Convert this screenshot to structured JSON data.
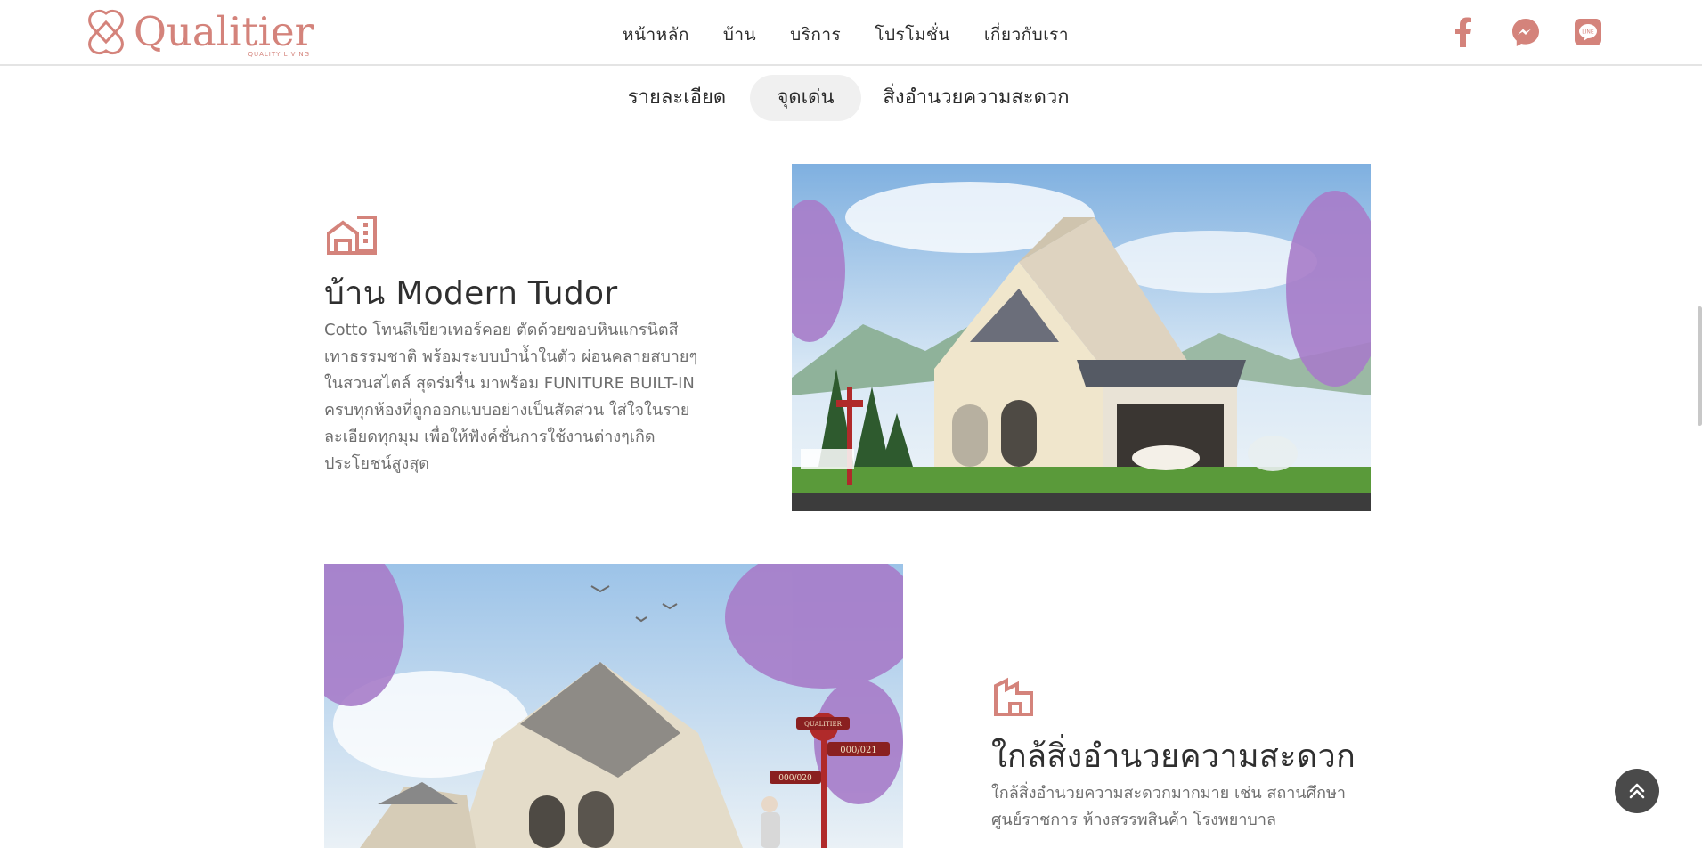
{
  "header": {
    "logo_text": "Qualitier",
    "logo_tagline": "QUALITY  LIVING",
    "nav": [
      "หน้าหลัก",
      "บ้าน",
      "บริการ",
      "โปรโมชั่น",
      "เกี่ยวกับเรา"
    ],
    "social_icons": [
      "facebook-icon",
      "messenger-icon",
      "line-icon"
    ]
  },
  "tabs": [
    "รายละเอียด",
    "จุดเด่น",
    "สิ่งอำนวยความสะดวก"
  ],
  "active_tab": "จุดเด่น",
  "sections": [
    {
      "icon": "house-building-icon",
      "title": "บ้าน Modern Tudor",
      "lines": [
        "Cotto โทนสีเขียวเทอร์คอย ตัดด้วยขอบหินแกรนิตสี",
        "เทาธรรมชาติ พร้อมระบบบำน้ำในตัว ผ่อนคลายสบายๆ",
        "ในสวนสไตล์ สุดร่มรื่น มาพร้อม FUNITURE BUILT-IN",
        "ครบทุกห้องที่ถูกออกแบบอย่างเป็นสัดส่วน ใส่ใจในราย",
        "ละเอียดทุกมุม เพื่อให้ฟังค์ชั่นการใช้งานต่างๆเกิด",
        "ประโยชน์สูงสุด"
      ]
    },
    {
      "icon": "building-icon",
      "title": "ใกล้สิ่งอำนวยความสะดวก",
      "lines": [
        "ใกล้สิ่งอำนวยความสะดวกมากมาย เช่น สถานศึกษา",
        "ศูนย์ราชการ ห้างสรรพสินค้า โรงพยาบาล"
      ]
    }
  ],
  "sign": {
    "brand": "QUALITIER",
    "left": "000/020",
    "right": "000/021"
  },
  "colors": {
    "brand": "#d4837b",
    "text": "#2b2b2b",
    "muted": "#6e6e6e",
    "tab_active_bg": "#f0f0f0",
    "scroll_btn": "#4a4a4a"
  }
}
